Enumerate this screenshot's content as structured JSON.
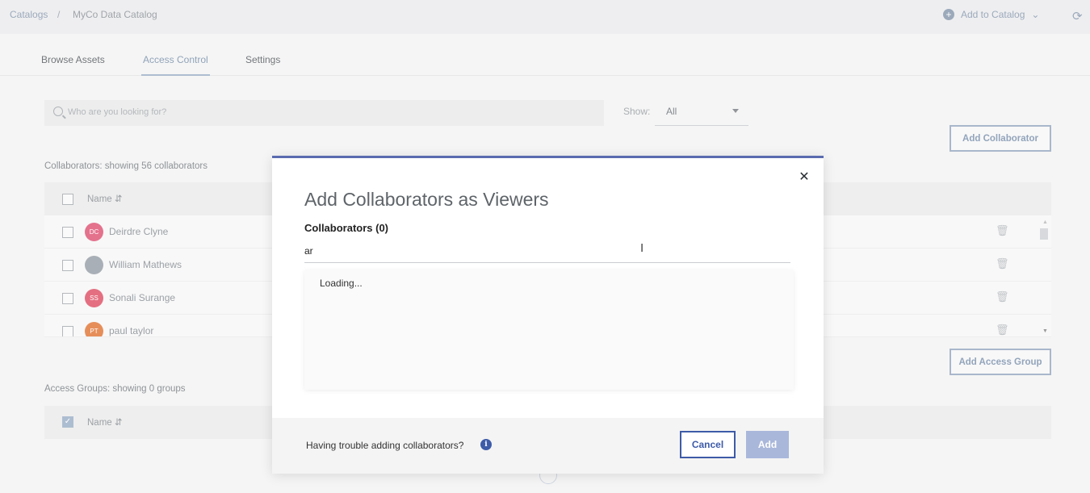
{
  "breadcrumb": {
    "root": "Catalogs",
    "separator": "/",
    "current": "MyCo Data Catalog"
  },
  "header": {
    "add_to_catalog": "Add to Catalog"
  },
  "tabs": [
    {
      "label": "Browse Assets"
    },
    {
      "label": "Access Control",
      "active": true
    },
    {
      "label": "Settings"
    }
  ],
  "search": {
    "placeholder": "Who are you looking for?"
  },
  "filter": {
    "label": "Show:",
    "value": "All"
  },
  "collaborators": {
    "summary": "Collaborators: showing 56 collaborators",
    "add_button": "Add Collaborator",
    "column": "Name",
    "rows": [
      {
        "initials": "DC",
        "name": "Deirdre Clyne",
        "color": "#e05a7a"
      },
      {
        "initials": "",
        "name": "William Mathews",
        "color": "#9aa2aa"
      },
      {
        "initials": "SS",
        "name": "Sonali Surange",
        "color": "#e0566c"
      },
      {
        "initials": "PT",
        "name": "paul taylor",
        "color": "#e27b3e"
      }
    ]
  },
  "groups": {
    "summary": "Access Groups: showing 0 groups",
    "add_button": "Add Access Group",
    "column": "Name"
  },
  "modal": {
    "title": "Add Collaborators as Viewers",
    "collaborators_label": "Collaborators (0)",
    "input_value": "ar",
    "loading": "Loading...",
    "help_text": "Having trouble adding collaborators?",
    "cancel": "Cancel",
    "add": "Add"
  },
  "colors": {
    "accent": "#3d5ba8",
    "modal_top": "#5a6bb0"
  }
}
